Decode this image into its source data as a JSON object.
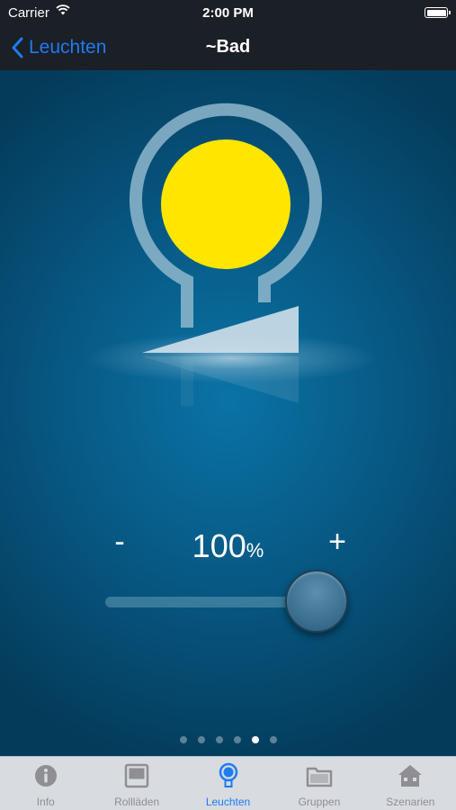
{
  "status_bar": {
    "carrier": "Carrier",
    "time": "2:00 PM"
  },
  "nav": {
    "back_label": "Leuchten",
    "title": "~Bad"
  },
  "light": {
    "brightness_value": "100",
    "brightness_unit": "%",
    "brightness_level": 1.0,
    "minus_label": "-",
    "plus_label": "+",
    "lamp_color": "#ffe600"
  },
  "pager": {
    "count": 6,
    "active_index": 4
  },
  "tabs": [
    {
      "label": "Info",
      "icon": "info-icon",
      "active": false
    },
    {
      "label": "Rollläden",
      "icon": "shutter-icon",
      "active": false
    },
    {
      "label": "Leuchten",
      "icon": "bulb-icon",
      "active": true
    },
    {
      "label": "Gruppen",
      "icon": "folder-icon",
      "active": false
    },
    {
      "label": "Szenarien",
      "icon": "house-icon",
      "active": false
    }
  ],
  "colors": {
    "accent": "#1e7cf0",
    "bar_background": "#1b1f26",
    "tab_inactive": "#8e8e93"
  }
}
